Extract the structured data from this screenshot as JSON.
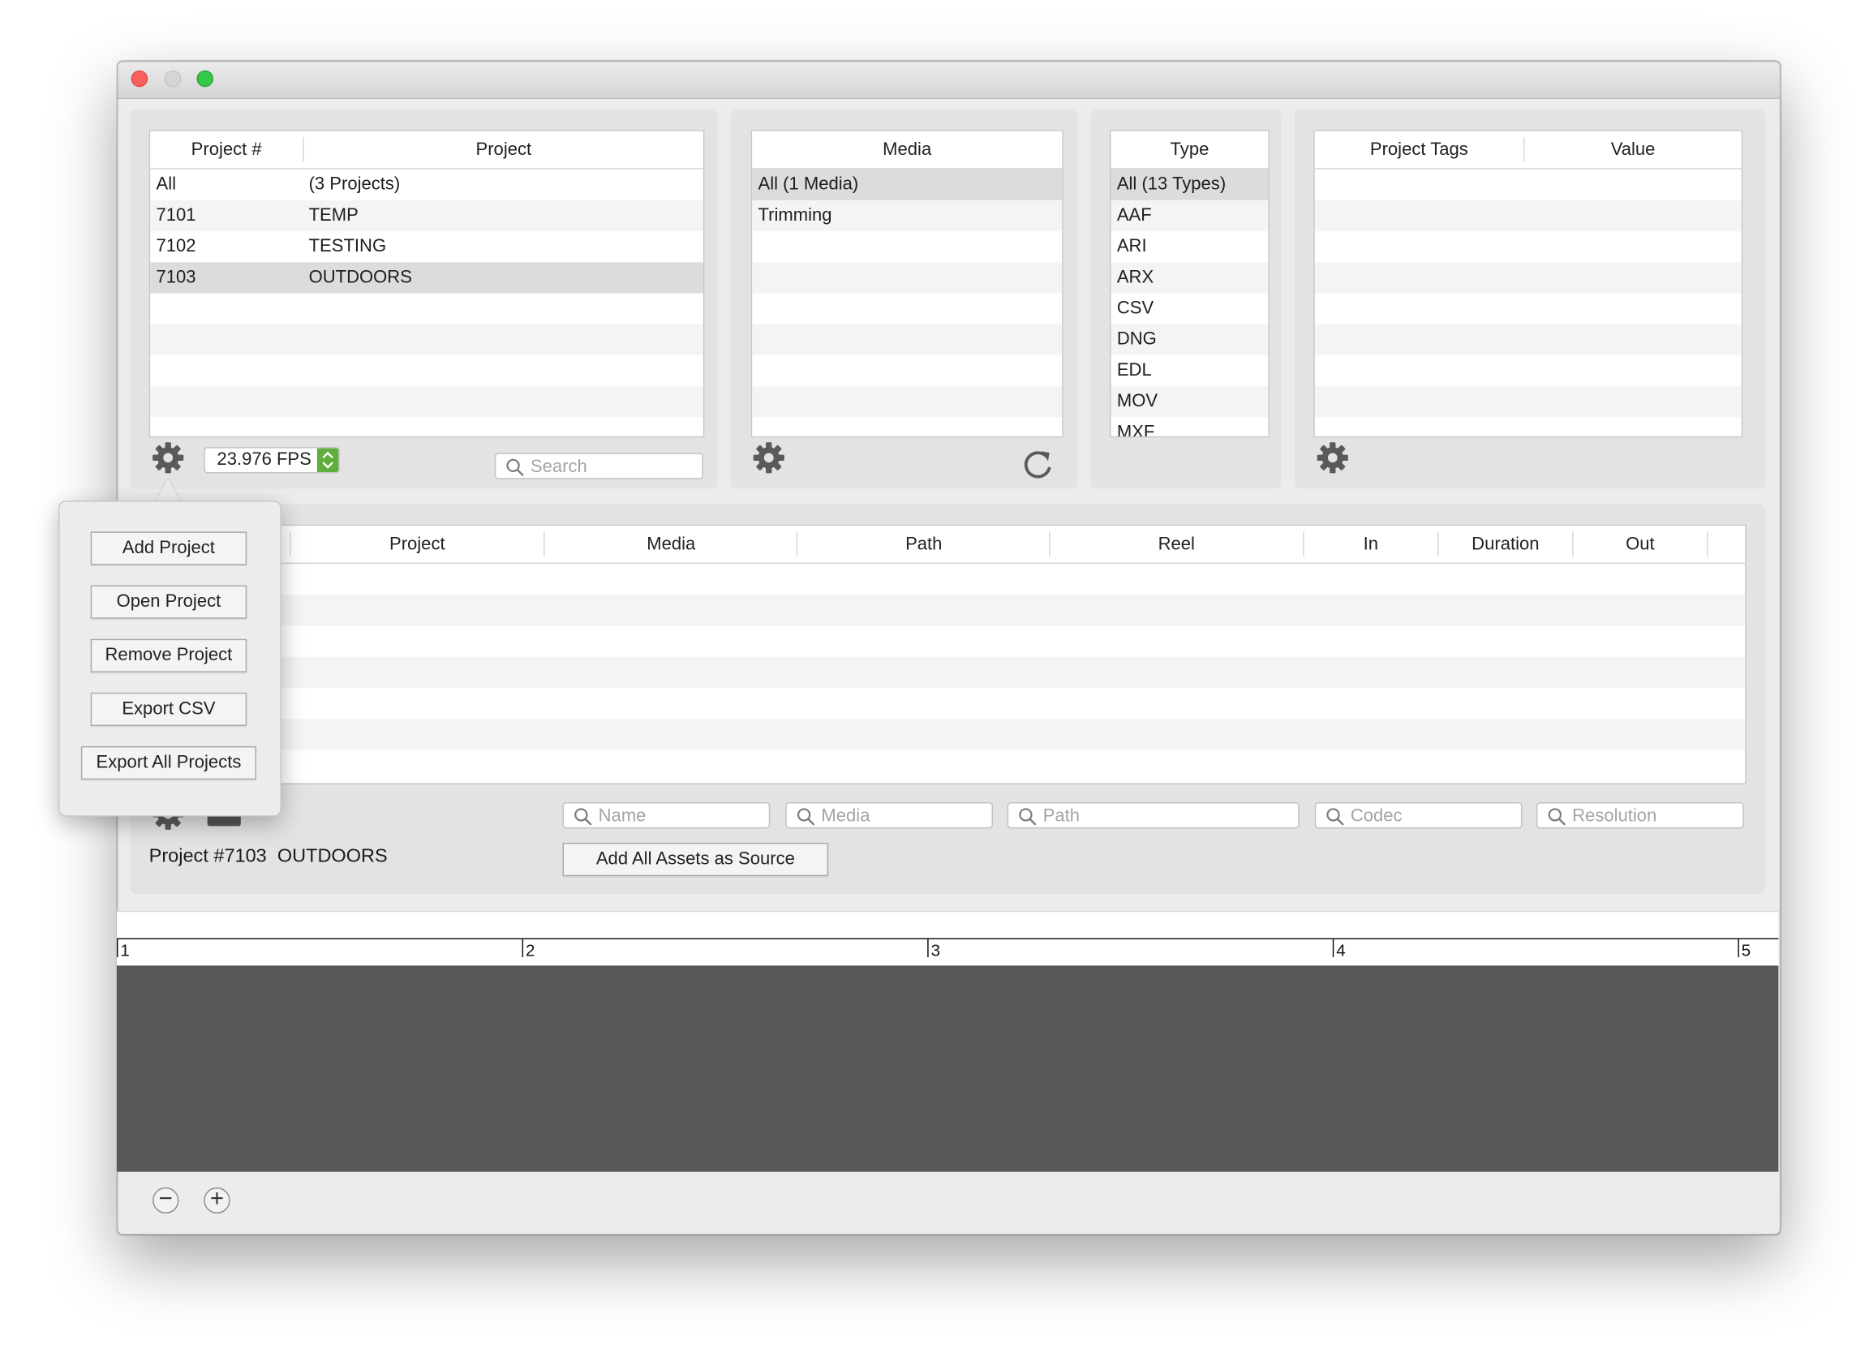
{
  "projects": {
    "columns": [
      "Project #",
      "Project"
    ],
    "rows": [
      {
        "num": "All",
        "name": "(3 Projects)"
      },
      {
        "num": "7101",
        "name": "TEMP"
      },
      {
        "num": "7102",
        "name": "TESTING"
      },
      {
        "num": "7103",
        "name": "OUTDOORS",
        "selected": true
      }
    ],
    "fps": "23.976 FPS",
    "search_placeholder": "Search"
  },
  "media": {
    "column": "Media",
    "rows": [
      {
        "label": "All (1 Media)",
        "selected": true
      },
      {
        "label": "Trimming"
      }
    ]
  },
  "types": {
    "column": "Type",
    "rows": [
      "All (13 Types)",
      "AAF",
      "ARI",
      "ARX",
      "CSV",
      "DNG",
      "EDL",
      "MOV",
      "MXF"
    ]
  },
  "tags": {
    "columns": [
      "Project Tags",
      "Value"
    ]
  },
  "assets": {
    "columns": [
      "Project",
      "Media",
      "Path",
      "Reel",
      "In",
      "Duration",
      "Out"
    ],
    "filters": {
      "name": "Name",
      "media": "Media",
      "path": "Path",
      "codec": "Codec",
      "resolution": "Resolution"
    },
    "add_all_label": "Add All Assets as Source",
    "project_label": "Project #7103  OUTDOORS"
  },
  "popover": {
    "add_project": "Add Project",
    "open_project": "Open Project",
    "remove_project": "Remove Project",
    "export_csv": "Export CSV",
    "export_all": "Export All Projects"
  },
  "timeline": {
    "ticks": [
      "1",
      "2",
      "3",
      "4",
      "5"
    ]
  },
  "zoom": {
    "out": "−",
    "in": "+"
  },
  "colors": {
    "window_bg": "#ececec",
    "panel_bg": "#e3e3e3",
    "selection": "#dcdcdc",
    "fps_stepper": "#5fae3c",
    "timeline_bg": "#585858",
    "close": "#fc615d",
    "maximize": "#34c84a"
  }
}
